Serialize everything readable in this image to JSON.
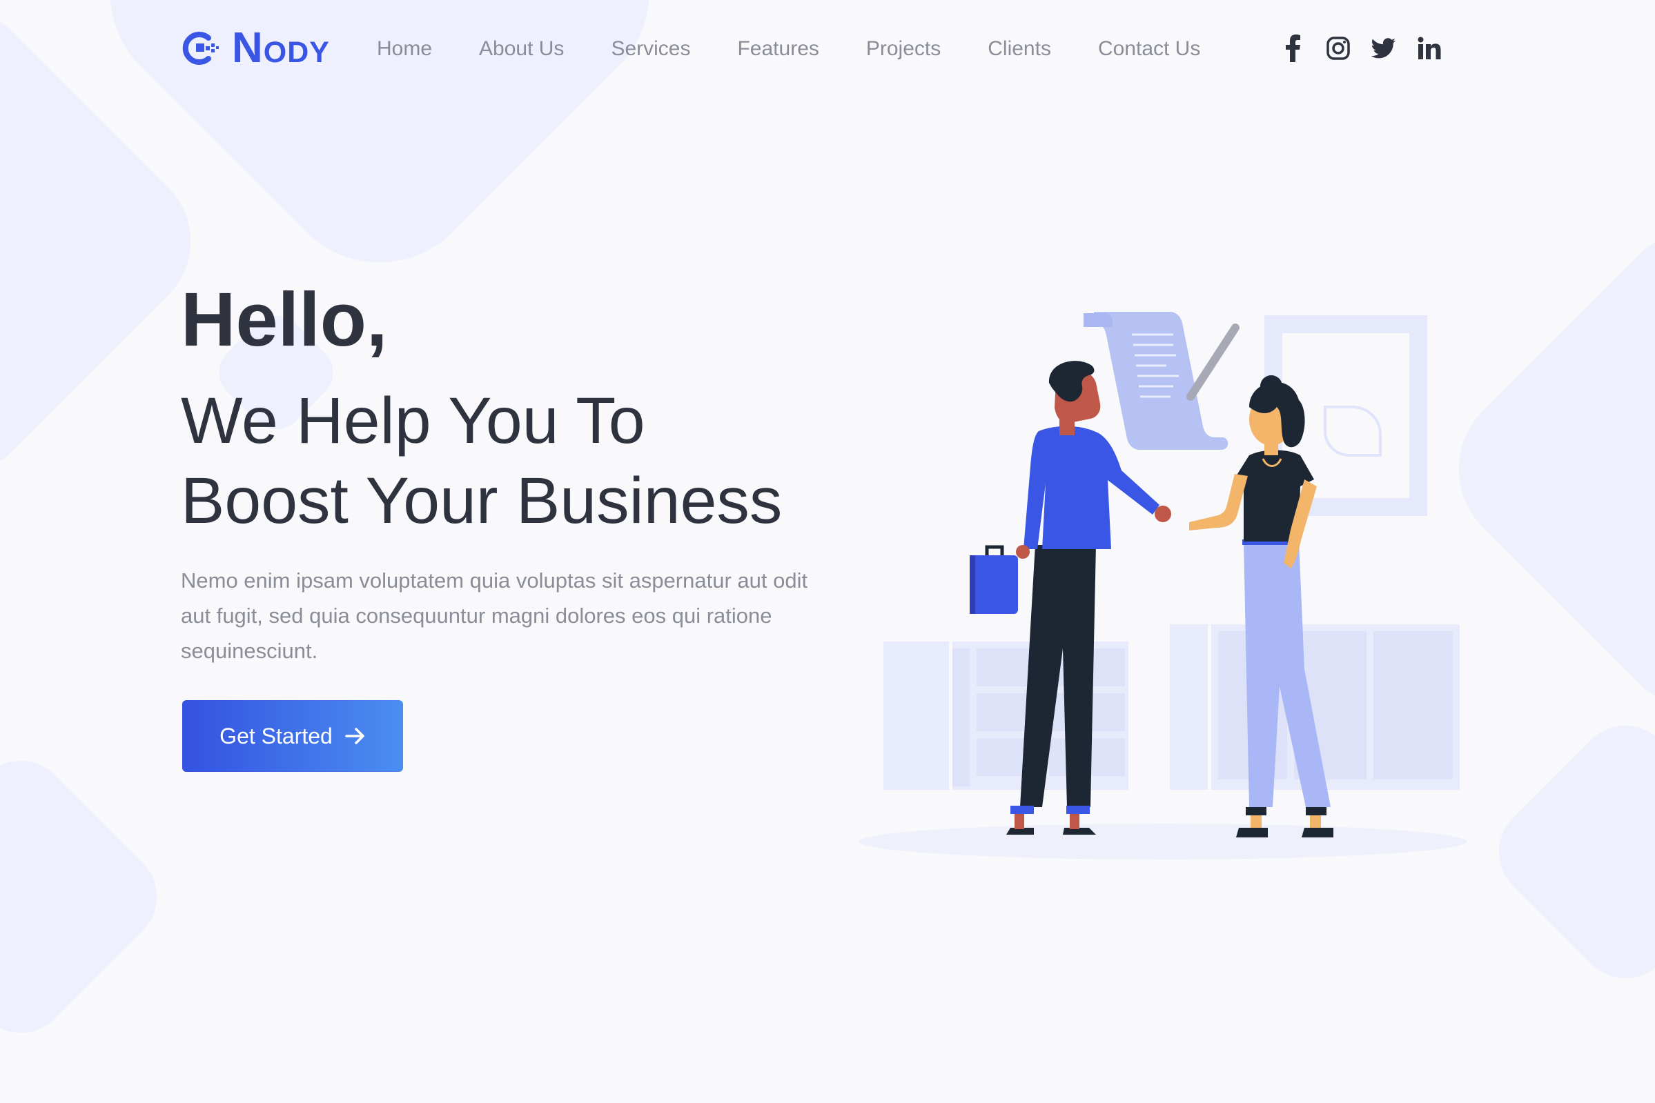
{
  "brand": {
    "name": "Nody",
    "accent": "#3a56e4"
  },
  "nav": {
    "items": [
      {
        "label": "Home"
      },
      {
        "label": "About Us"
      },
      {
        "label": "Services"
      },
      {
        "label": "Features"
      },
      {
        "label": "Projects"
      },
      {
        "label": "Clients"
      },
      {
        "label": "Contact Us"
      }
    ]
  },
  "social": {
    "icons": [
      "facebook-icon",
      "instagram-icon",
      "twitter-icon",
      "linkedin-icon"
    ]
  },
  "hero": {
    "greeting": "Hello,",
    "title_line1": "We Help You To",
    "title_line2": "Boost Your Business",
    "description": "Nemo enim ipsam voluptatem quia voluptas sit aspernatur aut odit aut fugit, sed quia consequuntur magni dolores eos qui ratione sequinesciunt.",
    "cta_label": "Get Started",
    "cta_icon": "arrow-right-icon"
  },
  "colors": {
    "heading": "#2f3340",
    "muted_text": "#8a8d97",
    "cta_start": "#3452e1",
    "cta_end": "#4b8ef0",
    "background": "#f9f9fc",
    "shape": "#eef1fd"
  }
}
